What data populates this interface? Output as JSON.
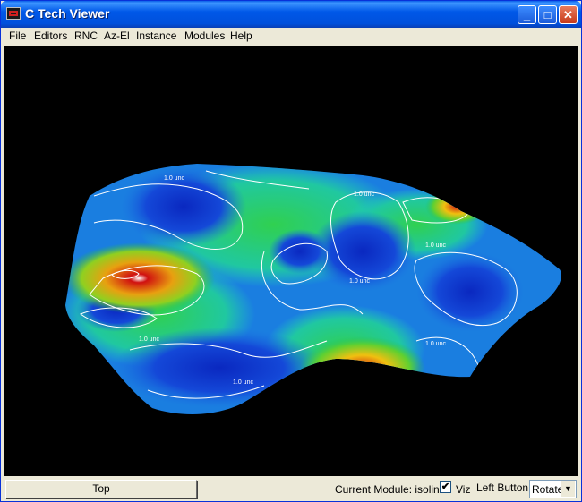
{
  "window": {
    "title": "C Tech Viewer",
    "controls": {
      "minimize": "_",
      "maximize": "□",
      "close": "✕"
    }
  },
  "menu": [
    "File",
    "Editors",
    "RNC",
    "Az-El",
    "Instance",
    "Modules",
    "Help"
  ],
  "view": {
    "isoline_label": "1.0 unc",
    "colors": {
      "background": "#000000",
      "low": "#1030d0",
      "mid": "#20c060",
      "high": "#e02010",
      "line": "#ffffff"
    }
  },
  "status": {
    "view_button": "Top",
    "current_module_label": "Current Module: isolines",
    "viz_label": "Viz",
    "viz_checked": "✔",
    "left_button_label": "Left Button",
    "left_button_value": "Rotate"
  },
  "icons": [
    "app-icon",
    "minimize-icon",
    "maximize-icon",
    "close-icon",
    "dropdown-arrow-icon"
  ]
}
